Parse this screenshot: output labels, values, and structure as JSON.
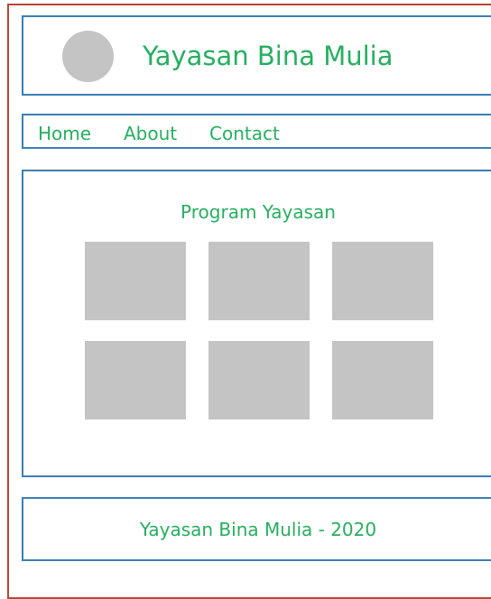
{
  "colors": {
    "accent_text": "#27ae60",
    "panel_border": "#3b7fb5",
    "outer_border": "#b5473a",
    "placeholder": "#c4c4c4"
  },
  "header": {
    "title": "Yayasan Bina Mulia",
    "logo_icon": "logo-placeholder-circle"
  },
  "nav": {
    "items": [
      {
        "label": "Home"
      },
      {
        "label": "About"
      },
      {
        "label": "Contact"
      }
    ]
  },
  "main": {
    "section_title": "Program Yayasan",
    "cards": [
      {
        "image": "program-image-placeholder"
      },
      {
        "image": "program-image-placeholder"
      },
      {
        "image": "program-image-placeholder"
      },
      {
        "image": "program-image-placeholder"
      },
      {
        "image": "program-image-placeholder"
      },
      {
        "image": "program-image-placeholder"
      }
    ]
  },
  "footer": {
    "text": "Yayasan Bina Mulia - 2020"
  }
}
